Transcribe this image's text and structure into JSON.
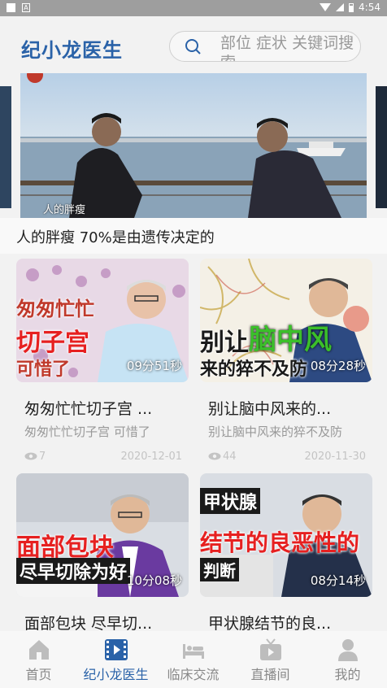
{
  "status_bar": {
    "time": "4:54",
    "notification": "A"
  },
  "header": {
    "title": "纪小龙医生",
    "search_placeholder": "部位 症状 关键词搜索"
  },
  "banner": {
    "caption": "人的胖瘦",
    "title": "人的胖瘦 70%是由遗传决定的"
  },
  "videos": [
    {
      "overlay_text": [
        "匆匆忙忙",
        "切子宫",
        "可惜了"
      ],
      "duration": "09分51秒",
      "title": "匆匆忙忙切子宫 ...",
      "subtitle": "匆匆忙忙切子宫 可惜了",
      "views": "7",
      "date": "2020-12-01"
    },
    {
      "overlay_text": [
        "别让",
        "脑中风",
        "来的猝不及防"
      ],
      "duration": "08分28秒",
      "title": "别让脑中风来的...",
      "subtitle": "别让脑中风来的猝不及防",
      "views": "44",
      "date": "2020-11-30"
    },
    {
      "overlay_text": [
        "面部包块",
        "尽早切除为好"
      ],
      "duration": "10分08秒",
      "title": "面部包块 尽早切...",
      "subtitle": "",
      "views": "",
      "date": ""
    },
    {
      "overlay_text": [
        "甲状腺",
        "结节的良恶性的",
        "判断"
      ],
      "duration": "08分14秒",
      "title": "甲状腺结节的良...",
      "subtitle": "",
      "views": "",
      "date": ""
    }
  ],
  "tabs": [
    {
      "label": "首页",
      "icon": "home-icon"
    },
    {
      "label": "纪小龙医生",
      "icon": "video-icon"
    },
    {
      "label": "临床交流",
      "icon": "bed-icon"
    },
    {
      "label": "直播间",
      "icon": "tv-icon"
    },
    {
      "label": "我的",
      "icon": "person-icon"
    }
  ],
  "colors": {
    "accent": "#2a62a8",
    "inactive_tab": "#bdbdbd"
  }
}
